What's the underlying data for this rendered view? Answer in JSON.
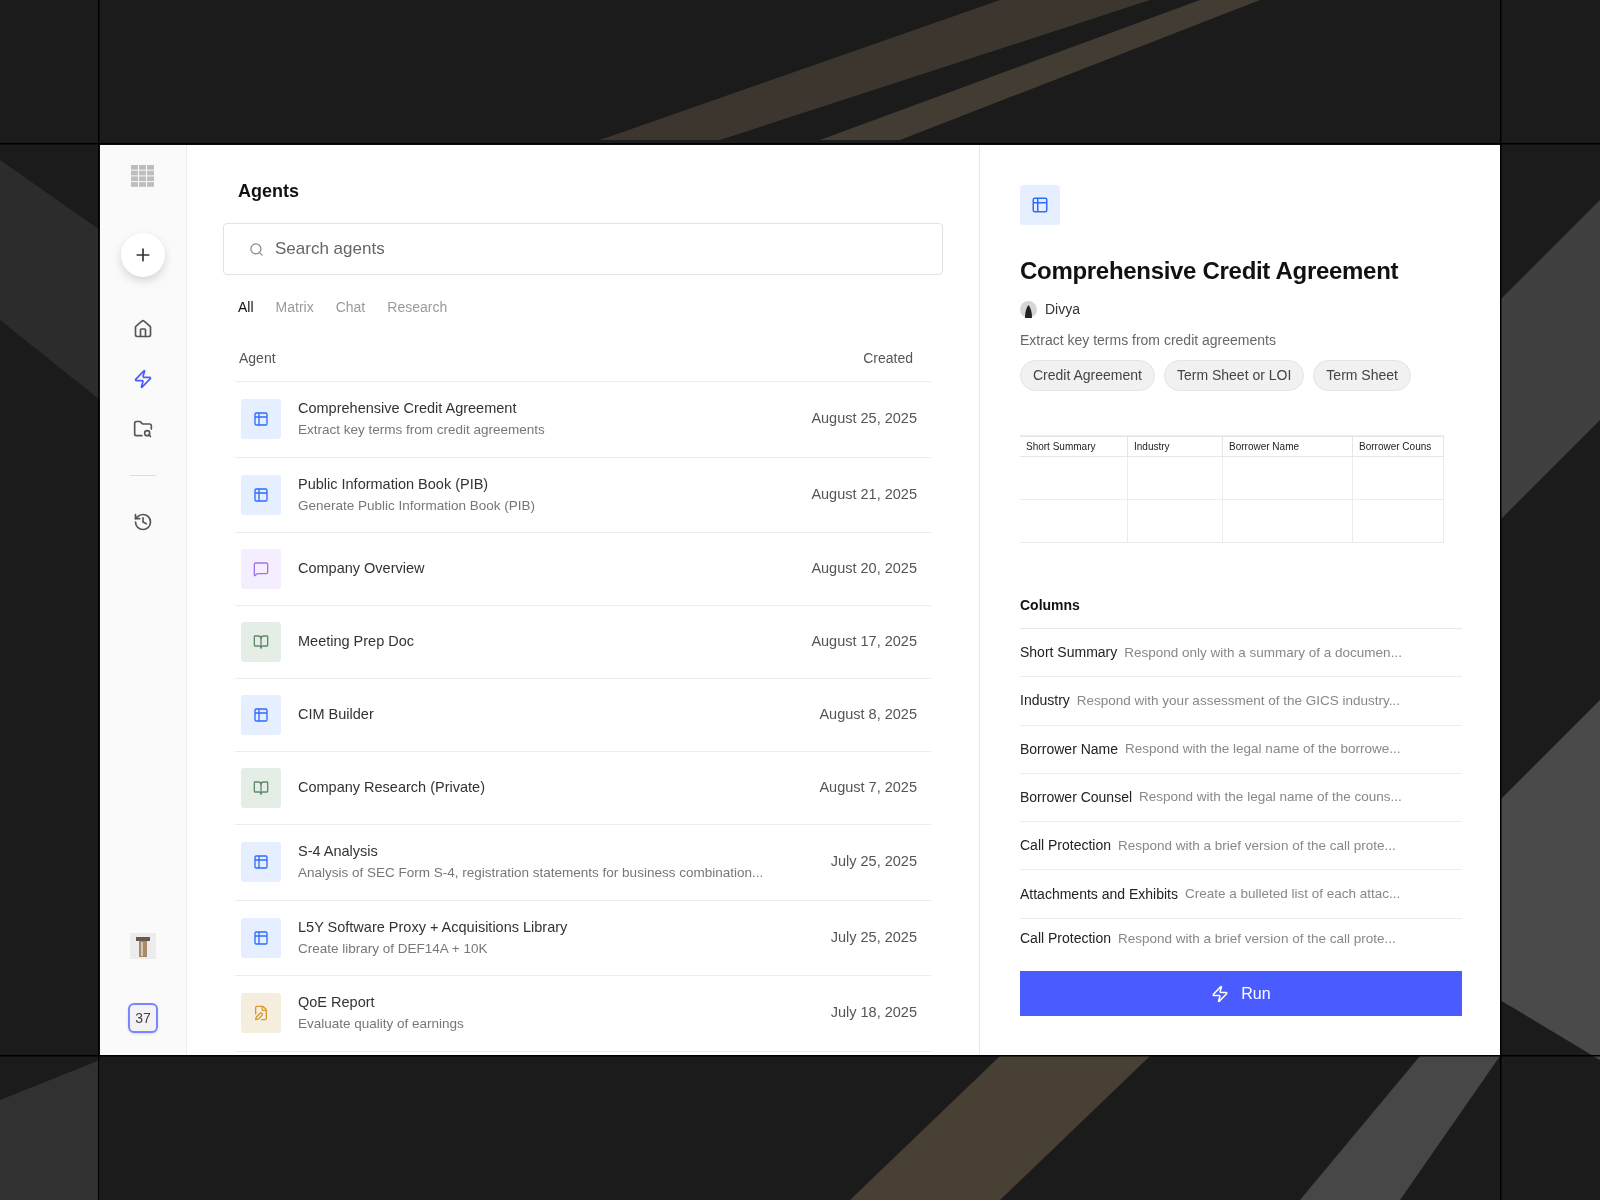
{
  "sidebar": {
    "nav": [
      {
        "kind": "home",
        "selected": false
      },
      {
        "kind": "agents",
        "selected": true
      },
      {
        "kind": "files",
        "selected": false
      },
      {
        "kind": "history",
        "selected": false
      }
    ],
    "badge": "37"
  },
  "main": {
    "title": "Agents",
    "search": {
      "placeholder": "Search agents"
    },
    "filters": [
      {
        "label": "All",
        "selected": true
      },
      {
        "label": "Matrix",
        "selected": false
      },
      {
        "label": "Chat",
        "selected": false
      },
      {
        "label": "Research",
        "selected": false
      }
    ],
    "columns": [
      "Agent",
      "Created"
    ],
    "agents": [
      {
        "kind": "matrix",
        "name": "Comprehensive Credit Agreement",
        "description": "Extract key terms from credit agreements",
        "created": "August 25, 2025"
      },
      {
        "kind": "matrix",
        "name": "Public Information Book (PIB)",
        "description": "Generate Public Information Book (PIB)",
        "created": "August 21, 2025"
      },
      {
        "kind": "chat",
        "name": "Company Overview",
        "created": "August 20, 2025"
      },
      {
        "kind": "research",
        "name": "Meeting Prep Doc",
        "created": "August 17, 2025"
      },
      {
        "kind": "matrix",
        "name": "CIM Builder",
        "created": "August 8, 2025"
      },
      {
        "kind": "research",
        "name": "Company Research (Private)",
        "created": "August 7, 2025"
      },
      {
        "kind": "matrix",
        "name": "S-4 Analysis",
        "description": "Analysis of SEC Form S-4, registration statements for business combination...",
        "created": "July 25, 2025"
      },
      {
        "kind": "matrix",
        "name": "L5Y Software Proxy + Acquisitions Library",
        "description": "Create library of DEF14A + 10K",
        "created": "July 25, 2025"
      },
      {
        "kind": "report",
        "name": "QoE Report",
        "description": "Evaluate quality of earnings",
        "created": "July 18, 2025"
      }
    ]
  },
  "detail": {
    "title": "Comprehensive Credit Agreement",
    "author": "Divya",
    "description": "Extract key terms from credit agreements",
    "tags": [
      "Credit Agreement",
      "Term Sheet or LOI",
      "Term Sheet"
    ],
    "preview_headers": [
      "Short Summary",
      "Industry",
      "Borrower Name",
      "Borrower Couns"
    ],
    "columns_title": "Columns",
    "columns": [
      {
        "name": "Short Summary",
        "prompt": "Respond only with a summary of a documen..."
      },
      {
        "name": "Industry",
        "prompt": "Respond with your assessment of the GICS industry..."
      },
      {
        "name": "Borrower Name",
        "prompt": "Respond with the legal name of the borrowe..."
      },
      {
        "name": "Borrower Counsel",
        "prompt": "Respond with the legal name of the couns..."
      },
      {
        "name": "Call Protection",
        "prompt": "Respond with a brief version of the call prote..."
      },
      {
        "name": "Attachments and Exhibits",
        "prompt": "Create a bulleted list of each attac..."
      },
      {
        "name": "Call Protection",
        "prompt": "Respond with a brief version of the call prote..."
      }
    ],
    "run_label": "Run"
  }
}
